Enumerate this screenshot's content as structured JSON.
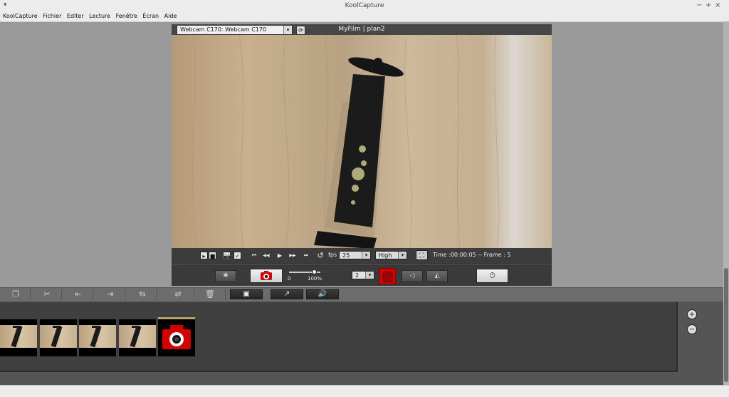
{
  "window": {
    "title": "KoolCapture"
  },
  "menu": [
    "KoolCapture",
    "Fichier",
    "Editer",
    "Lecture",
    "Fenêtre",
    "Écran",
    "Aide"
  ],
  "viewer": {
    "camera": "Webcam C170: Webcam C170",
    "film_title": "MyFilm | plan2",
    "fps_label": "fps",
    "fps_value": "25",
    "quality_value": "High",
    "time_info": "Time :00:00:05 -- Frame  : 5",
    "slider_min": "0",
    "slider_max": "100%",
    "slider_level": 0.8,
    "onion_value": "2"
  },
  "icons": {
    "menu": "▾",
    "minimize": "−",
    "maximize": "+",
    "close": "×",
    "refresh": "⟳",
    "play": "▸",
    "stop": "■",
    "check": "✓",
    "first": "⏮",
    "rewind": "◀◀",
    "play_main": "▶",
    "forward": "▶▶",
    "last": "⏭",
    "loop": "↺",
    "dropdown": "▾",
    "fullscreen": "⛶",
    "light": "✱",
    "camera": "📷",
    "record": "●",
    "flip_h": "◁",
    "flip_v": "◭",
    "timer": "⏱",
    "duplicate": "❐",
    "cut": "✂",
    "insert_before": "⇤",
    "insert_after": "⇥",
    "replace": "⇆",
    "swap": "⇄",
    "trash": "🗑",
    "images": "▣",
    "export": "↗",
    "sound": "🔊",
    "zoom_in": "+",
    "zoom_out": "−"
  },
  "colors": {
    "record": "#d60000",
    "accent_bar": "#b8a46a"
  }
}
